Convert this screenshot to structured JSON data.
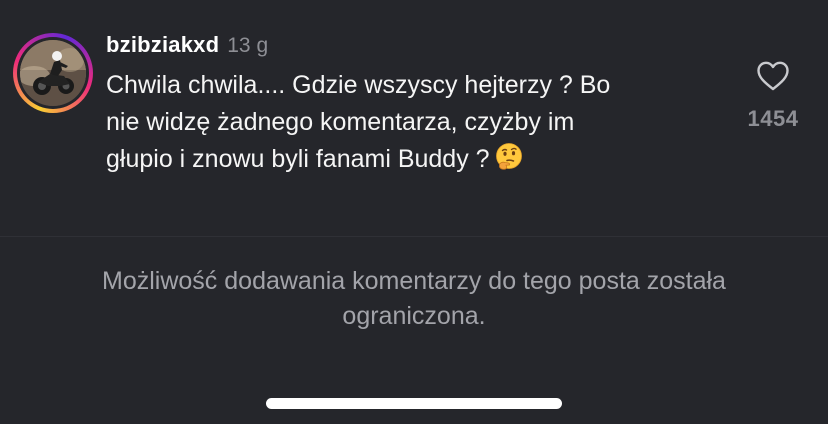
{
  "comment": {
    "username": "bzibziakxd",
    "time": "13 g",
    "text_lines": [
      "Chwila chwila.... Gdzie wszyscy hejterzy ? Bo",
      "nie widzę żadnego komentarza, czyżby im",
      "głupio i znowu byli fanami Buddy ?"
    ],
    "emoji": "thinking-face-icon",
    "avatar": "avatar-motorcycle-photo",
    "like_icon": "heart-outline-icon",
    "like_count": "1454"
  },
  "footer": {
    "restricted_notice": "Możliwość dodawania komentarzy do tego posta została ograniczona."
  },
  "colors": {
    "background": "#25262b",
    "secondary_text": "#8e8f95",
    "notice_text": "#a3a4aa",
    "avatar_ring_start": "#f9ce34",
    "avatar_ring_mid": "#ee2a7b",
    "avatar_ring_end": "#6228d7"
  }
}
